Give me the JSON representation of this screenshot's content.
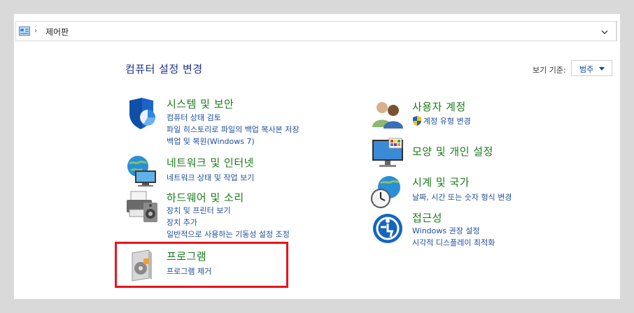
{
  "address": {
    "path": "제어판"
  },
  "header": {
    "title": "컴퓨터 설정 변경",
    "view_by_label": "보기 기준:",
    "view_by_value": "범주"
  },
  "categories": {
    "system": {
      "title": "시스템 및 보안",
      "links": [
        "컴퓨터 상태 검토",
        "파일 히스토리로 파일의 백업 복사본 저장",
        "백업 및 복원(Windows 7)"
      ]
    },
    "network": {
      "title": "네트워크 및 인터넷",
      "links": [
        "네트워크 상태 및 작업 보기"
      ]
    },
    "hardware": {
      "title": "하드웨어 및 소리",
      "links": [
        "장치 및 프린터 보기",
        "장치 추가",
        "일반적으로 사용하는 기동성 설정 조정"
      ]
    },
    "programs": {
      "title": "프로그램",
      "links": [
        "프로그램 제거"
      ]
    },
    "users": {
      "title": "사용자 계정",
      "links": [
        "계정 유형 변경"
      ]
    },
    "appearance": {
      "title": "모양 및 개인 설정",
      "links": []
    },
    "clock": {
      "title": "시계 및 국가",
      "links": [
        "날짜, 시간 또는 숫자 형식 변경"
      ]
    },
    "access": {
      "title": "접근성",
      "links": [
        "Windows 권장 설정",
        "시각적 디스플레이 최적화"
      ]
    }
  },
  "colors": {
    "title_green": "#1a7b1a",
    "link_blue": "#1f4fa0",
    "highlight_red": "#e8141a"
  }
}
